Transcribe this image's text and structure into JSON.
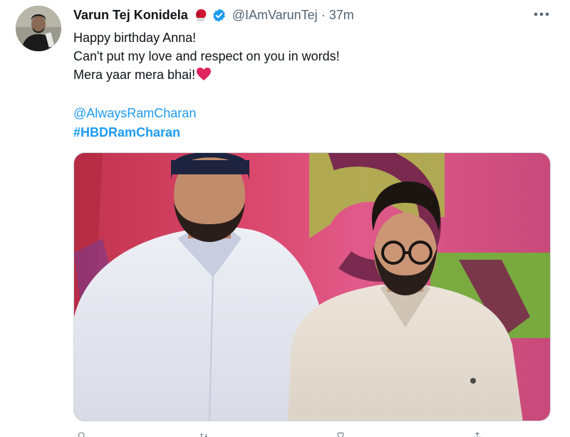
{
  "tweet": {
    "author_name": "Varun Tej Konidela",
    "author_handle": "@IAmVarunTej",
    "separator": "·",
    "time": "37m",
    "lines": [
      "Happy birthday Anna!",
      "Can't put my love and respect on you in words!",
      "Mera yaar mera bhai!"
    ],
    "mention": "@AlwaysRamCharan",
    "hashtag": "#HBDRamCharan"
  },
  "icons": {
    "name_emoji": "boxing-glove-icon",
    "badge": "verified-badge-icon",
    "menu": "more-icon",
    "inline_emoji": "red-heart-icon",
    "actions": [
      "reply-icon",
      "retweet-icon",
      "like-icon",
      "share-icon"
    ]
  },
  "colors": {
    "text_primary": "#0f1419",
    "text_secondary": "#536471",
    "link": "#1d9bf0",
    "verified": "#1d9bf0",
    "heart": "#e0245e"
  }
}
